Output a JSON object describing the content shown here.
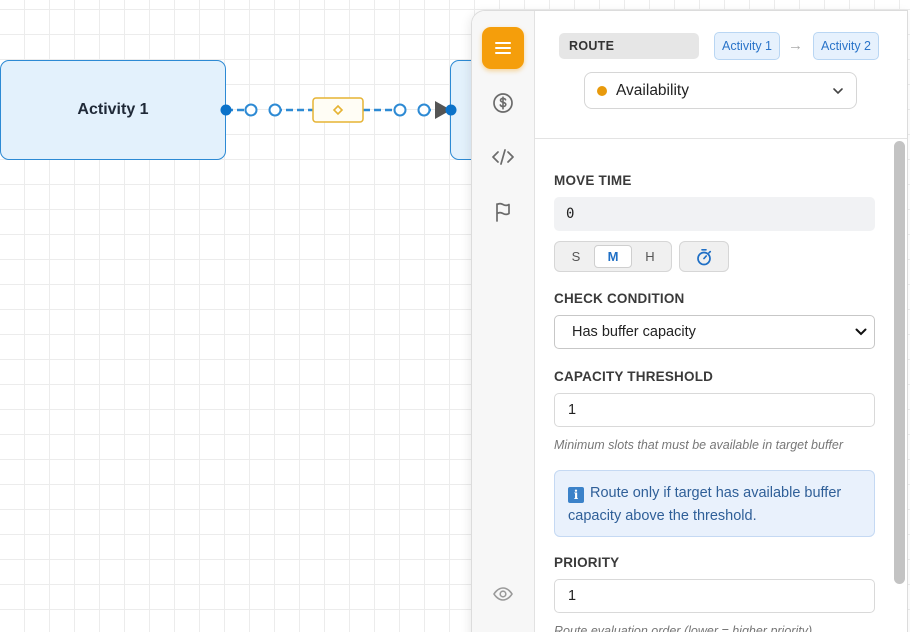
{
  "canvas": {
    "node1": {
      "label": "Activity 1"
    },
    "node2": {
      "label": ""
    },
    "edge": {
      "color": "#2d8ad4",
      "marker_color": "#e6b333",
      "marker_icon": "diamond-icon"
    }
  },
  "panel": {
    "rail": {
      "items": [
        {
          "name": "menu-icon",
          "active": true
        },
        {
          "name": "dollar-icon",
          "active": false
        },
        {
          "name": "code-icon",
          "active": false
        },
        {
          "name": "flag-icon",
          "active": false
        },
        {
          "name": "eye-icon",
          "active": false
        }
      ]
    },
    "header": {
      "route_label": "ROUTE",
      "from": "Activity 1",
      "to": "Activity 2",
      "arrow": "→",
      "type_value": "Availability",
      "type_dot_color": "#e89a0c"
    },
    "move_time": {
      "label": "MOVE TIME",
      "value": "0",
      "units": [
        "S",
        "M",
        "H"
      ],
      "selected_unit": "M"
    },
    "check_condition": {
      "label": "CHECK CONDITION",
      "value": "Has buffer capacity"
    },
    "capacity_threshold": {
      "label": "CAPACITY THRESHOLD",
      "value": "1",
      "hint": "Minimum slots that must be available in target buffer"
    },
    "info": {
      "icon_text": "i",
      "text": "Route only if target has available buffer capacity above the threshold."
    },
    "priority": {
      "label": "PRIORITY",
      "value": "1",
      "hint": "Route evaluation order (lower = higher priority)."
    }
  },
  "colors": {
    "accent": "#f59e0b",
    "link_blue": "#2a74c9",
    "node_fill": "#e3f1fc",
    "node_border": "#2d8ad4",
    "info_bg": "#e9f1fc"
  }
}
